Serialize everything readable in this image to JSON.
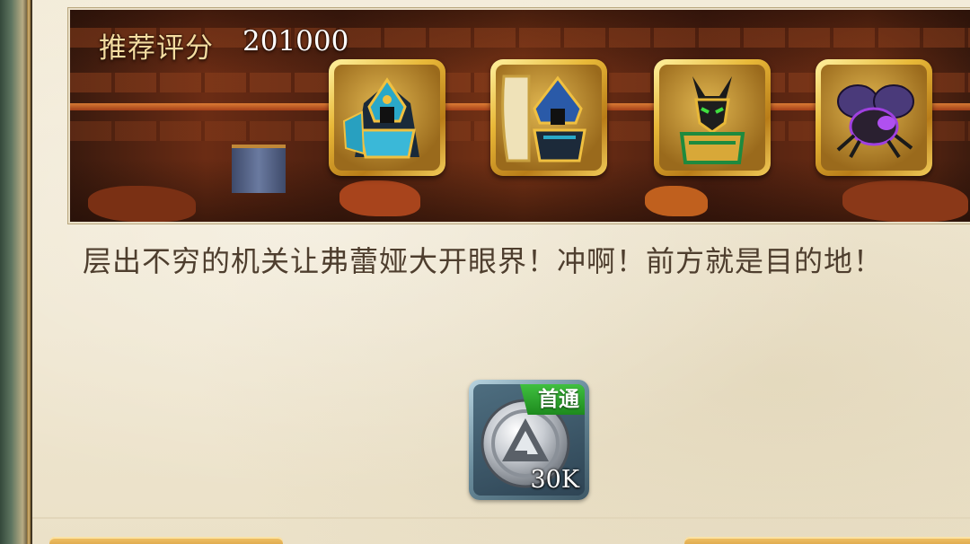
{
  "banner": {
    "score_label": "推荐评分",
    "score_value": "201000"
  },
  "recommended_units": [
    {
      "name": "pharaoh-warrior-icon"
    },
    {
      "name": "pharaoh-shield-icon"
    },
    {
      "name": "anubis-warrior-icon"
    },
    {
      "name": "scarab-beetle-icon"
    }
  ],
  "stage": {
    "description": "层出不穷的机关让弗蕾娅大开眼界！冲啊！前方就是目的地！"
  },
  "reward": {
    "item_icon": "silver-coin-icon",
    "first_clear_tag": "首通",
    "quantity": "30K"
  },
  "colors": {
    "parchment": "#efe6d0",
    "banner_frame": "#e9dfc7",
    "unit_frame_gold": "#e8b838",
    "first_clear_green": "#2ea82e",
    "text_brown": "#4e3e2e"
  }
}
